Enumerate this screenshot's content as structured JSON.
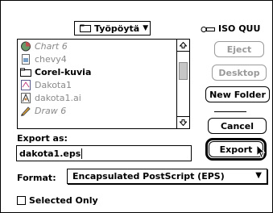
{
  "folder_popup": {
    "label": "Työpöytä",
    "arrow": "▼"
  },
  "disk": {
    "label": "ISO QUU"
  },
  "file_list": {
    "items": [
      {
        "label": "Chart 6",
        "style": "dim-italic",
        "icon": "chart-file-icon"
      },
      {
        "label": "chevy4",
        "style": "dim",
        "icon": "image-file-icon"
      },
      {
        "label": "Corel-kuvia",
        "style": "bold",
        "icon": "folder-icon"
      },
      {
        "label": "Dakota1",
        "style": "dim",
        "icon": "document-file-icon"
      },
      {
        "label": "dakota1.ai",
        "style": "dim",
        "icon": "illustrator-file-icon"
      },
      {
        "label": "Draw 6",
        "style": "dim-italic",
        "icon": "draw-app-icon"
      }
    ]
  },
  "buttons": {
    "eject": "Eject",
    "desktop": "Desktop",
    "new_folder": "New Folder",
    "cancel": "Cancel",
    "export": "Export"
  },
  "export_as": {
    "label": "Export as:",
    "value": "dakota1.eps"
  },
  "format": {
    "label": "Format:",
    "value": "Encapsulated PostScript (EPS)",
    "arrow": "▼"
  },
  "selected_only": {
    "label": "Selected Only",
    "checked": false
  }
}
